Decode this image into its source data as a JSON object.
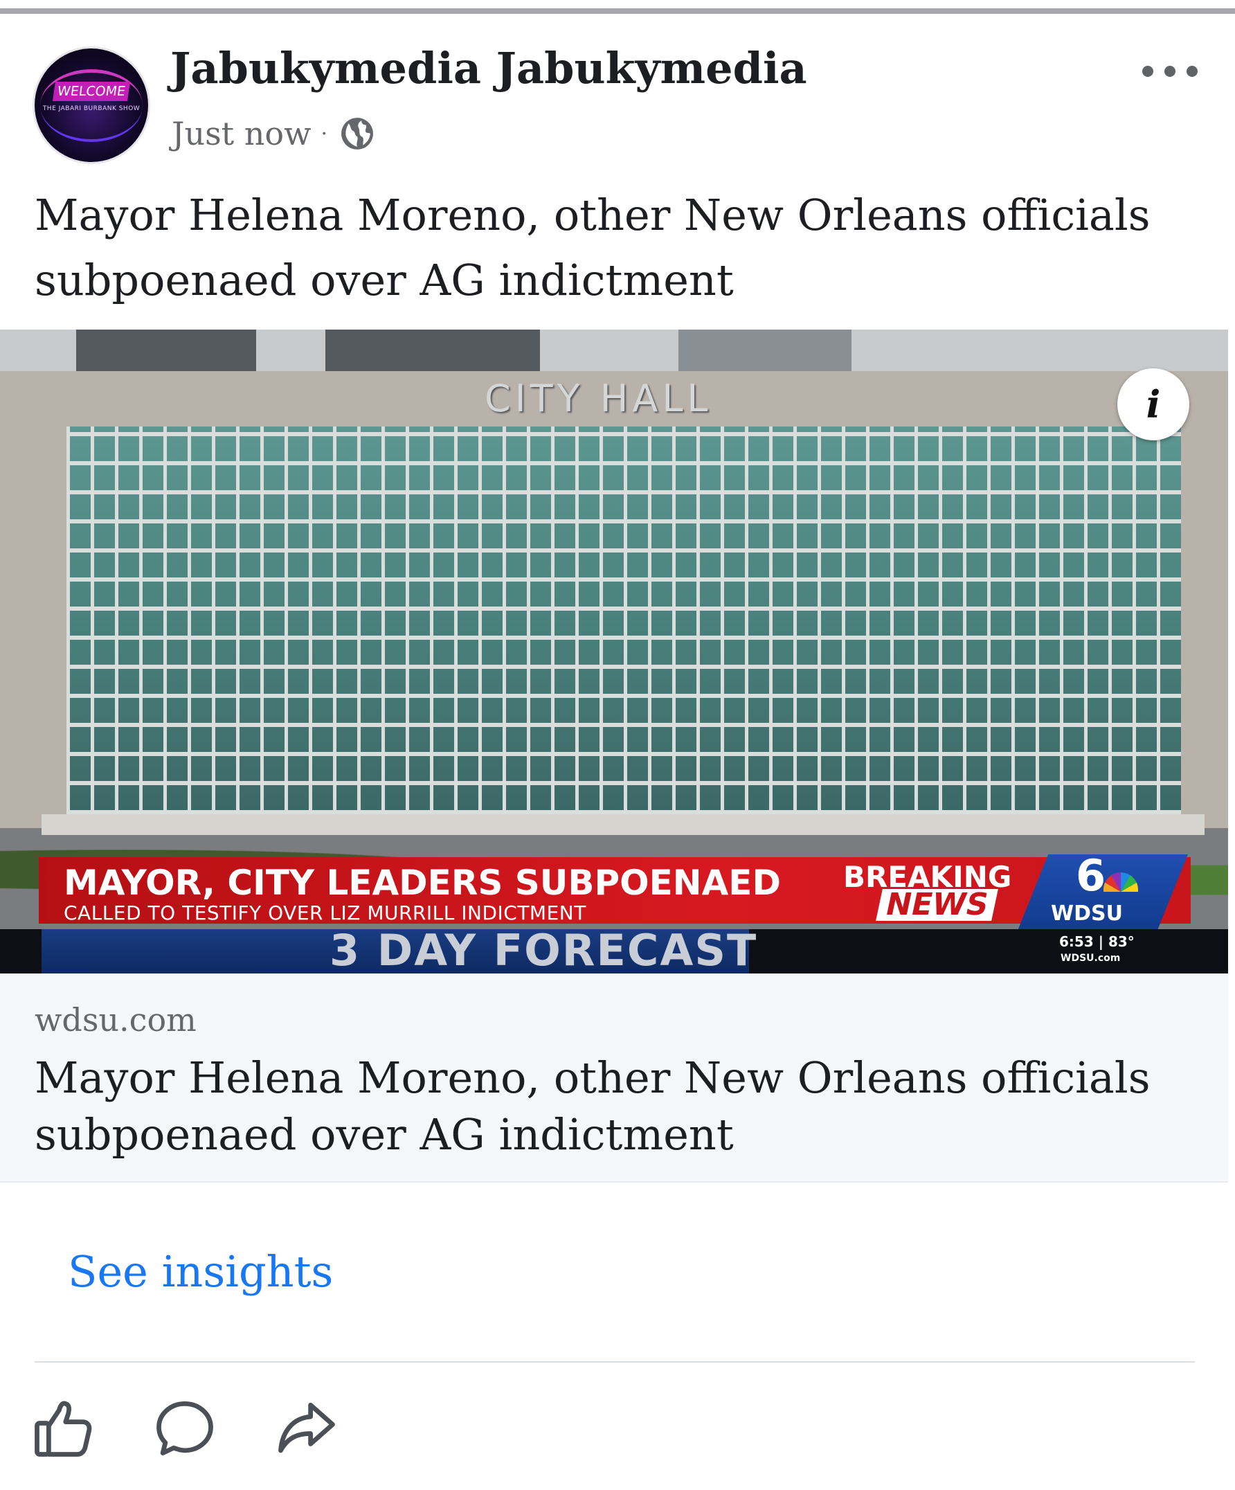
{
  "post": {
    "author": "Jabukymedia Jabukymedia",
    "timestamp": "Just now",
    "separator": "·",
    "audience_icon": "globe-icon",
    "more_icon": "more-options-icon",
    "caption": "Mayor Helena Moreno, other New Orleans officials subpoenaed over AG indictment",
    "avatar": {
      "banner_text": "WELCOME",
      "sub_text": "THE JABARI BURBANK SHOW"
    }
  },
  "media": {
    "building_sign": "CITY HALL",
    "info_icon_glyph": "i",
    "lower_third": {
      "headline": "MAYOR, CITY LEADERS SUBPOENAED",
      "subhead": "CALLED TO TESTIFY OVER LIZ MURRILL INDICTMENT",
      "breaking_line1": "BREAKING",
      "breaking_line2": "NEWS",
      "station_number": "6",
      "station": "WDSU",
      "ticker": "3 DAY FORECAST",
      "time_temp": "6:53 | 83°",
      "station_site": "WDSU.com"
    }
  },
  "link_preview": {
    "domain": "wdsu.com",
    "title": "Mayor Helena Moreno, other New Orleans officials subpoenaed over AG indictment"
  },
  "insights_label": "See insights",
  "actions": {
    "like_icon": "like-icon",
    "comment_icon": "comment-icon",
    "share_icon": "share-icon"
  },
  "colors": {
    "link_blue": "#1877f2",
    "secondary_text": "#65676b",
    "primary_text": "#1c1e21",
    "news_red": "#d71920",
    "news_blue": "#1f4fb0"
  }
}
